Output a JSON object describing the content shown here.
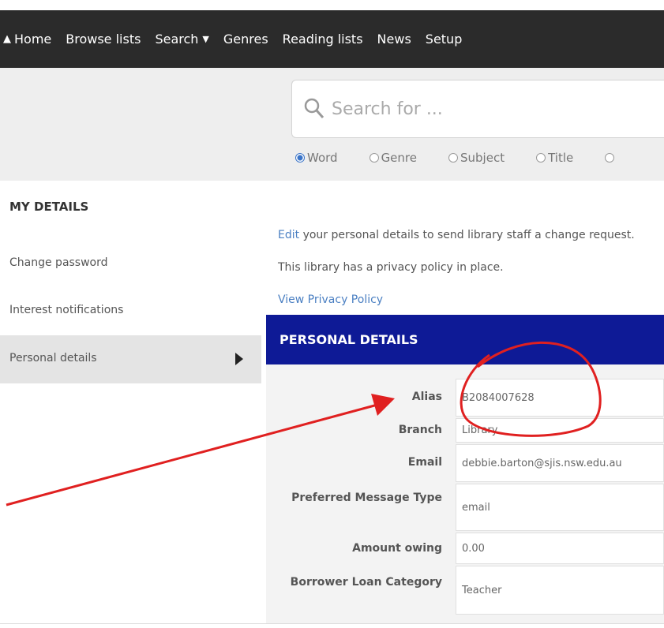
{
  "nav": {
    "items": [
      {
        "label": "Home",
        "icon": "home-icon"
      },
      {
        "label": "Browse lists"
      },
      {
        "label": "Search",
        "caret": true
      },
      {
        "label": "Genres"
      },
      {
        "label": "Reading lists"
      },
      {
        "label": "News"
      },
      {
        "label": "Setup"
      }
    ]
  },
  "search": {
    "placeholder": "Search for ...",
    "options": [
      {
        "label": "Word",
        "selected": true
      },
      {
        "label": "Genre",
        "selected": false
      },
      {
        "label": "Subject",
        "selected": false
      },
      {
        "label": "Title",
        "selected": false
      }
    ]
  },
  "sidebar": {
    "heading": "MY DETAILS",
    "items": [
      {
        "label": "Change password"
      },
      {
        "label": "Interest notifications"
      },
      {
        "label": "Personal details",
        "active": true
      }
    ]
  },
  "main": {
    "edit_link": "Edit",
    "edit_text": " your personal details to send library staff a change request.",
    "privacy_text": "This library has a privacy policy in place.",
    "privacy_link": "View Privacy Policy"
  },
  "personal": {
    "title": "PERSONAL DETAILS",
    "fields": [
      {
        "label": "Alias",
        "value": "B2084007628"
      },
      {
        "label": "Branch",
        "value": "Library"
      },
      {
        "label": "Email",
        "value": "debbie.barton@sjis.nsw.edu.au"
      },
      {
        "label": "Preferred Message Type",
        "value": "email"
      },
      {
        "label": "Amount owing",
        "value": "0.00"
      },
      {
        "label": "Borrower Loan Category",
        "value": "Teacher"
      }
    ]
  },
  "colors": {
    "header_bar": "#2b2b2b",
    "panel_header": "#0e1a96",
    "link": "#4a7fc2",
    "annotation": "#e02020"
  }
}
